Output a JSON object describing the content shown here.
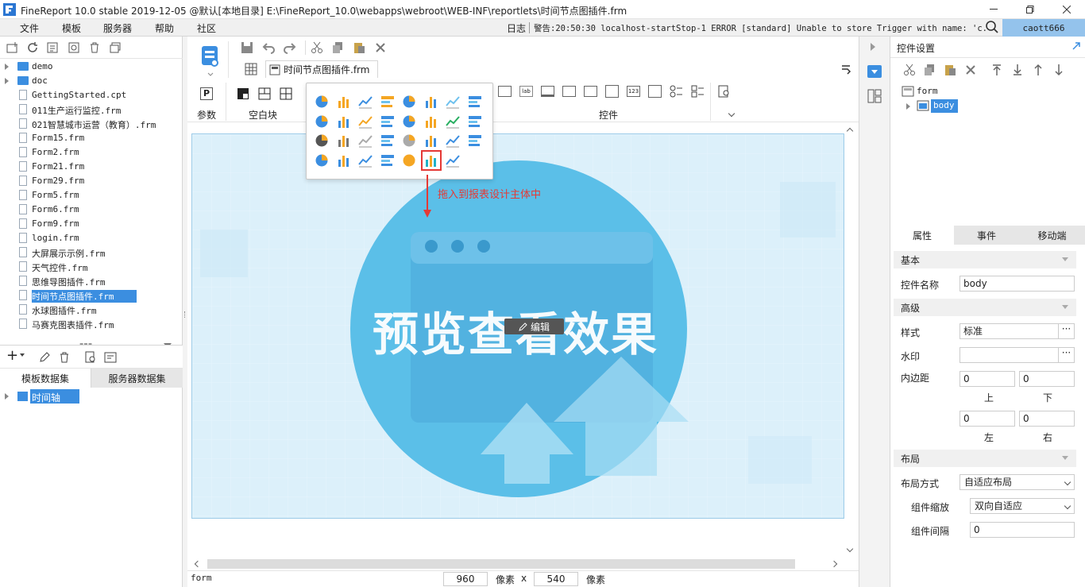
{
  "window": {
    "title": "FineReport 10.0 stable 2019-12-05 @默认[本地目录]    E:\\FineReport_10.0\\webapps\\webroot\\WEB-INF\\reportlets\\时间节点图插件.frm"
  },
  "menu": {
    "items": [
      "文件",
      "模板",
      "服务器",
      "帮助",
      "社区"
    ],
    "log_label": "日志",
    "warning_text": "警告:20:50:30 localhost-startStop-1 ERROR [standard] Unable to store Trigger with name: 'c...",
    "user": "caott666"
  },
  "file_tree": {
    "items": [
      {
        "label": "demo",
        "type": "folder"
      },
      {
        "label": "doc",
        "type": "folder"
      },
      {
        "label": "GettingStarted.cpt",
        "type": "file"
      },
      {
        "label": "011生产运行监控.frm",
        "type": "file"
      },
      {
        "label": "021智慧城市运营（教育）.frm",
        "type": "file"
      },
      {
        "label": "Form15.frm",
        "type": "file"
      },
      {
        "label": "Form2.frm",
        "type": "file"
      },
      {
        "label": "Form21.frm",
        "type": "file"
      },
      {
        "label": "Form29.frm",
        "type": "file"
      },
      {
        "label": "Form5.frm",
        "type": "file"
      },
      {
        "label": "Form6.frm",
        "type": "file"
      },
      {
        "label": "Form9.frm",
        "type": "file"
      },
      {
        "label": "login.frm",
        "type": "file"
      },
      {
        "label": "大屏展示示例.frm",
        "type": "file"
      },
      {
        "label": "天气控件.frm",
        "type": "file"
      },
      {
        "label": "思维导图插件.frm",
        "type": "file"
      },
      {
        "label": "时间节点图插件.frm",
        "type": "file",
        "selected": true
      },
      {
        "label": "水球图插件.frm",
        "type": "file"
      },
      {
        "label": "马赛克图表插件.frm",
        "type": "file"
      }
    ]
  },
  "datasets": {
    "tabs": [
      "模板数据集",
      "服务器数据集"
    ],
    "items": [
      "时间轴"
    ]
  },
  "editor": {
    "file_tab": "时间节点图插件.frm",
    "sections": {
      "param": "参数",
      "blank": "空白块",
      "controls": "控件"
    },
    "popup_hint": "拖入到报表设计主体中",
    "canvas_text": "预览查看效果",
    "edit_badge": "编辑",
    "status": {
      "name": "form",
      "width": "960",
      "unit1": "像素",
      "x": "x",
      "height": "540",
      "unit2": "像素"
    }
  },
  "right_panel": {
    "title": "控件设置",
    "tree": {
      "root": "form",
      "child": "body"
    },
    "tabs": [
      "属性",
      "事件",
      "移动端"
    ],
    "basic": {
      "header": "基本",
      "name_label": "控件名称",
      "name_value": "body"
    },
    "advanced": {
      "header": "高级",
      "style_label": "样式",
      "style_value": "标准",
      "watermark_label": "水印",
      "watermark_value": "",
      "padding_label": "内边距",
      "top_value": "0",
      "bottom_value": "0",
      "left_value": "0",
      "right_value": "0",
      "top_label": "上",
      "bottom_label": "下",
      "left_label": "左",
      "right_label": "右"
    },
    "layout": {
      "header": "布局",
      "mode_label": "布局方式",
      "mode_value": "自适应布局",
      "scale_label": "组件缩放",
      "scale_value": "双向自适应",
      "gap_label": "组件间隔",
      "gap_value": "0"
    }
  },
  "colors": {
    "accent": "#3b8ee0",
    "highlight_red": "#e53935",
    "canvas_circle": "#5bbfe8"
  }
}
